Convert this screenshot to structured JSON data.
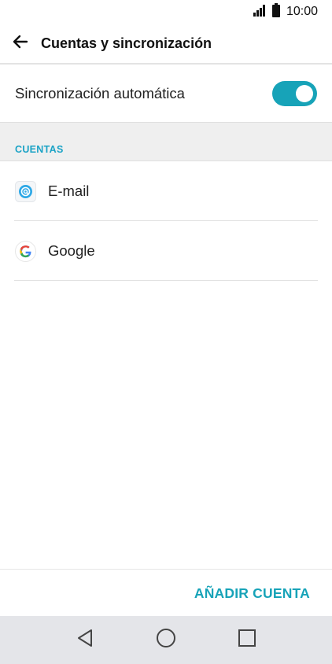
{
  "status_bar": {
    "time": "10:00",
    "icons": [
      "signal-icon",
      "battery-icon"
    ]
  },
  "app_bar": {
    "back_icon": "arrow-left-icon",
    "title": "Cuentas y sincronización"
  },
  "sync": {
    "label": "Sincronización automática",
    "enabled": true,
    "accent_color": "#17a3b8"
  },
  "accounts_section": {
    "header": "CUENTAS",
    "items": [
      {
        "label": "E-mail",
        "icon": "at-sign-icon"
      },
      {
        "label": "Google",
        "icon": "google-icon"
      }
    ]
  },
  "footer": {
    "add_account_label": "AÑADIR CUENTA"
  },
  "nav_bar": {
    "buttons": [
      "back-triangle-icon",
      "home-circle-icon",
      "recents-square-icon"
    ]
  }
}
